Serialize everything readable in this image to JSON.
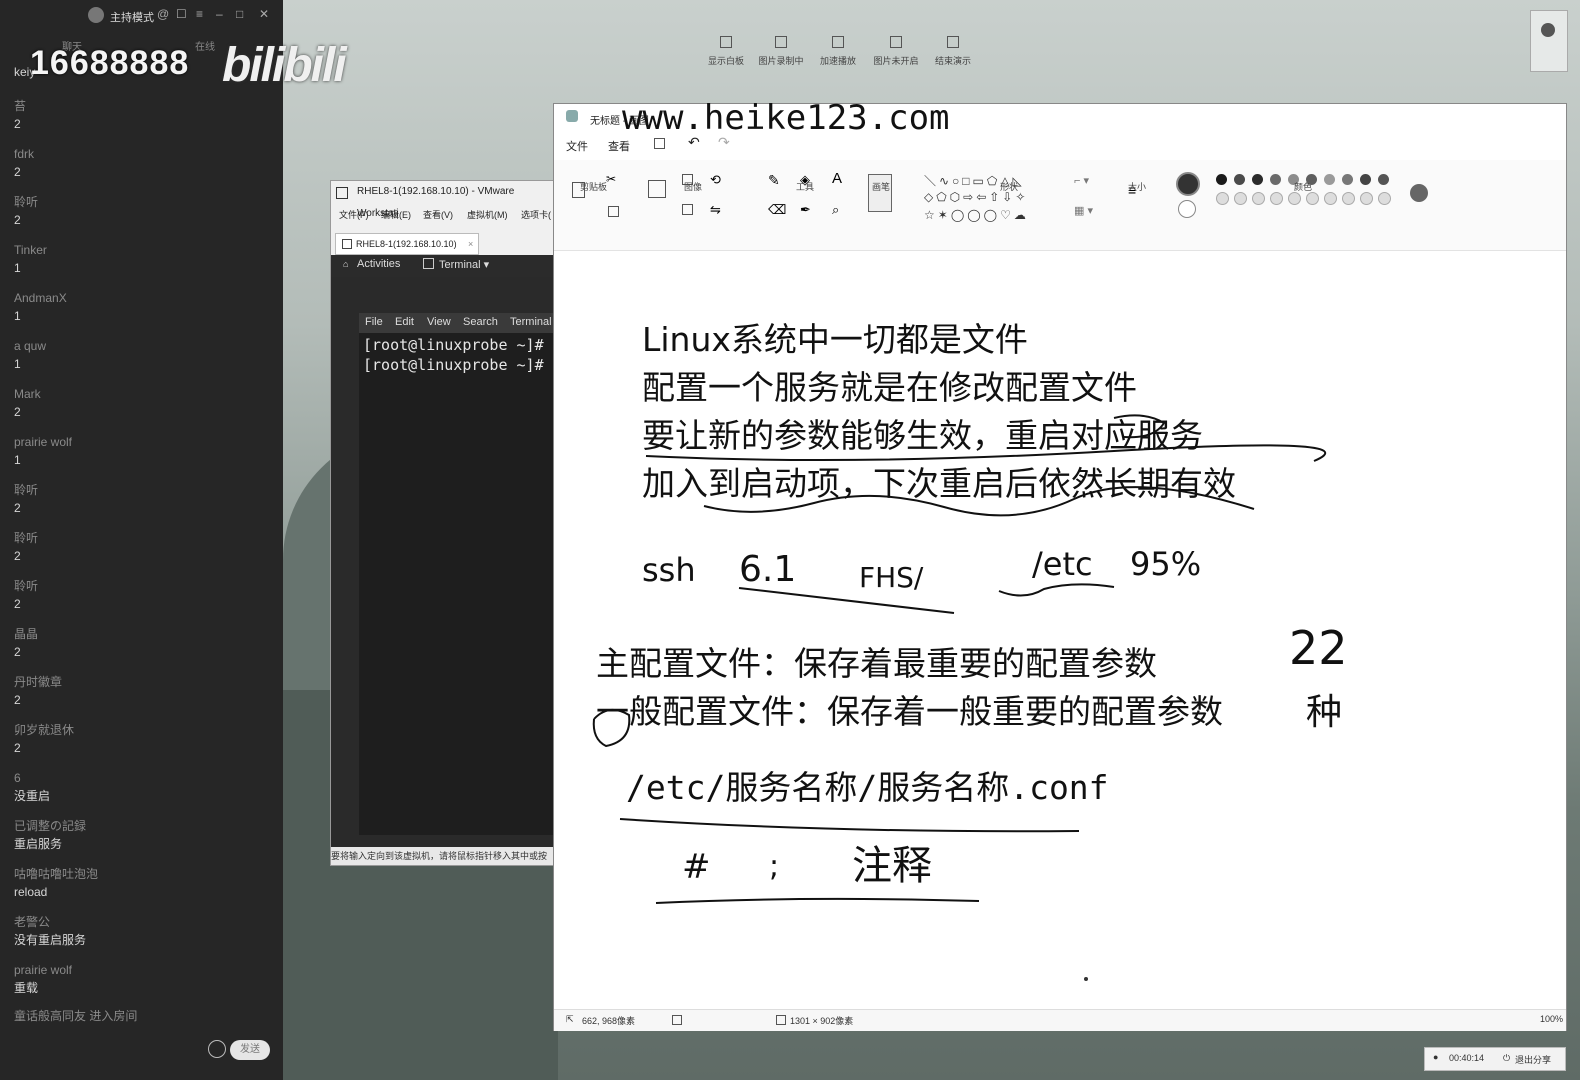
{
  "chat": {
    "mode_label": "主持模式",
    "tabs": [
      "聊天",
      "在线"
    ],
    "first_user": "keiy",
    "messages": [
      {
        "user": "苔",
        "text": "2"
      },
      {
        "user": "fdrk",
        "text": "2"
      },
      {
        "user": "聆听",
        "text": "2"
      },
      {
        "user": "Tinker",
        "text": "1"
      },
      {
        "user": "AndmanX",
        "text": "1"
      },
      {
        "user": "a quw",
        "text": "1"
      },
      {
        "user": "Mark",
        "text": "2"
      },
      {
        "user": "prairie wolf",
        "text": "1"
      },
      {
        "user": "聆听",
        "text": "2"
      },
      {
        "user": "聆听",
        "text": "2"
      },
      {
        "user": "聆听",
        "text": "2"
      },
      {
        "user": "晶晶",
        "text": "2"
      },
      {
        "user": "丹时徽章",
        "text": "2"
      },
      {
        "user": "卯岁就退休",
        "text": "2"
      },
      {
        "user": "6",
        "text": "没重启"
      },
      {
        "user": "已调整の記録",
        "text": "重启服务"
      },
      {
        "user": "咕噜咕噜吐泡泡",
        "text": "reload"
      },
      {
        "user": "老警公",
        "text": "没有重启服务"
      },
      {
        "user": "prairie wolf",
        "text": "重载"
      }
    ],
    "join_notice": "童话般高同友 进入房间",
    "send_label": "发送"
  },
  "overlay": {
    "number": "16688888",
    "logo": "bilibili",
    "site": "www.heike123.com"
  },
  "share_toolbar": [
    "显示白板",
    "图片录制中",
    "加速播放",
    "图片未开启",
    "结束演示"
  ],
  "vmware": {
    "title": "RHEL8-1(192.168.10.10) - VMware Workstati",
    "menu": [
      "文件(F)",
      "编辑(E)",
      "查看(V)",
      "虚拟机(M)",
      "选项卡("
    ],
    "tab_label": "RHEL8-1(192.168.10.10)",
    "activities": "Activities",
    "terminal_menu": "Terminal ▾",
    "term_menu": [
      "File",
      "Edit",
      "View",
      "Search",
      "Terminal"
    ],
    "term_lines": [
      "[root@linuxprobe ~]#",
      "[root@linuxprobe ~]#"
    ],
    "status": "要将输入定向到该虚拟机，请将鼠标指针移入其中或按"
  },
  "paint": {
    "title": "无标题 - 画图",
    "menu": [
      "文件",
      "查看"
    ],
    "groups": [
      "剪贴板",
      "图像",
      "工具",
      "画笔",
      "形状",
      "大小",
      "颜色"
    ],
    "palette": [
      "#1a1a1a",
      "#4a4a4a",
      "#2b2b2b",
      "#6a6a6a",
      "#8c8c8c",
      "#5e5e5e",
      "#9a9a9a",
      "#777777",
      "#444444",
      "#555555"
    ],
    "status_left": "662, 968像素",
    "status_size": "1301 × 902像素",
    "zoom": "100%",
    "lines": [
      "Linux系统中一切都是文件",
      "配置一个服务就是在修改配置文件",
      "要让新的参数能够生效，重启对应服务",
      "加入到启动项，下次重启后依然长期有效"
    ],
    "ssh": "ssh",
    "hw_61": "6.1",
    "hw_fhs": "FHS/",
    "etc": "/etc",
    "pct": "95%",
    "main_conf": "主配置文件：保存着最重要的配置参数",
    "gen_conf": "一般配置文件：保存着一般重要的配置参数",
    "path": "/etc/服务名称/服务名称.conf",
    "hash": "#",
    "semi": ";",
    "zhushi": "注释",
    "hw_22": "22",
    "hw_hw": "种"
  },
  "share_status": {
    "time": "00:40:14",
    "exit": "退出分享"
  }
}
